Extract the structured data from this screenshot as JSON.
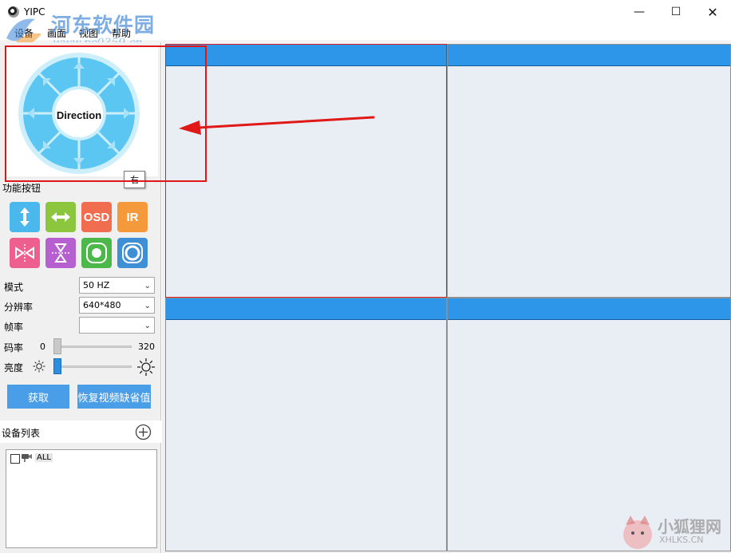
{
  "window": {
    "title": "YIPC"
  },
  "watermark": {
    "site_name": "河东软件园",
    "site_url": "www.pc0359.cn",
    "corner_name": "小狐狸网",
    "corner_url": "XHLKS.CN"
  },
  "menu": {
    "items": [
      "设备",
      "画面",
      "视图",
      "帮助"
    ]
  },
  "ptz": {
    "center_label": "Direction",
    "tooltip": "右"
  },
  "functions": {
    "label": "功能按钮",
    "buttons": [
      {
        "name": "vertical-flip",
        "text": "",
        "color": "#4ab8ec"
      },
      {
        "name": "horizontal-flip",
        "text": "",
        "color": "#8cc63f"
      },
      {
        "name": "osd",
        "text": "OSD",
        "color": "#f06d4f"
      },
      {
        "name": "ir",
        "text": "IR",
        "color": "#f59a3c"
      },
      {
        "name": "mirror",
        "text": "",
        "color": "#ec5f8f"
      },
      {
        "name": "flip",
        "text": "",
        "color": "#b65fd1"
      },
      {
        "name": "record-green",
        "text": "",
        "color": "#4cb849"
      },
      {
        "name": "record-blue",
        "text": "",
        "color": "#3f8fd6"
      }
    ]
  },
  "settings": {
    "mode": {
      "label": "模式",
      "value": "50 HZ"
    },
    "resolution": {
      "label": "分辨率",
      "value": "640*480"
    },
    "framerate": {
      "label": "帧率",
      "value": ""
    },
    "bitrate": {
      "label": "码率",
      "min": "0",
      "max": "320",
      "value": 0
    },
    "brightness": {
      "label": "亮度",
      "value": 0
    }
  },
  "actions": {
    "get": "获取",
    "restore": "恢复视频缺省值"
  },
  "device_list": {
    "label": "设备列表",
    "items": [
      {
        "label": "ALL",
        "checked": false
      }
    ]
  },
  "colors": {
    "accent": "#2d96e8",
    "annotation": "#e01818"
  }
}
